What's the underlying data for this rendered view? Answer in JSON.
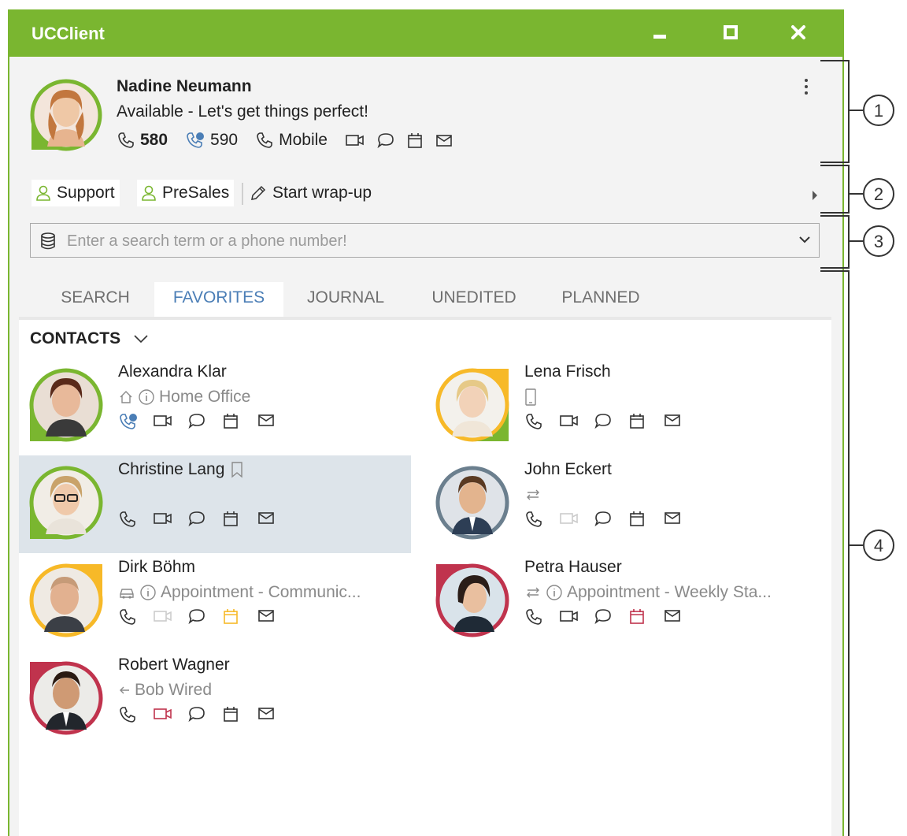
{
  "window": {
    "title": "UCClient",
    "accent": "#7ab630"
  },
  "profile": {
    "name": "Nadine Neumann",
    "status": "Available - Let's get things perfect!",
    "line1": "580",
    "line2": "590",
    "mobile": "Mobile",
    "ring_color": "#7ab630"
  },
  "groups": [
    {
      "label": "Support"
    },
    {
      "label": "PreSales"
    }
  ],
  "wrapup": {
    "label": "Start wrap-up"
  },
  "search": {
    "placeholder": "Enter a search term or a phone number!",
    "value": ""
  },
  "tabs": [
    {
      "label": "SEARCH",
      "active": false
    },
    {
      "label": "FAVORITES",
      "active": true
    },
    {
      "label": "JOURNAL",
      "active": false
    },
    {
      "label": "UNEDITED",
      "active": false
    },
    {
      "label": "PLANNED",
      "active": false
    }
  ],
  "category": {
    "label": "CONTACTS"
  },
  "contacts": [
    {
      "name": "Alexandra Klar",
      "status": "Home Office",
      "status_icon": "home-icon",
      "presence": "available",
      "ring": "#7ab630"
    },
    {
      "name": "Lena Frisch",
      "status": "",
      "status_icon": "mobile-icon",
      "presence": "away",
      "ring": "#f7b928"
    },
    {
      "name": "Christine Lang",
      "status": "",
      "status_icon": "",
      "presence": "available",
      "ring": "#7ab630",
      "selected": true,
      "bookmark": true
    },
    {
      "name": "John Eckert",
      "status": "",
      "status_icon": "offline-icon",
      "presence": "offline",
      "ring": "#6b7f8e"
    },
    {
      "name": "Dirk Böhm",
      "status": "Appointment - Communic...",
      "status_icon": "car-icon",
      "presence": "away",
      "ring": "#f7b928"
    },
    {
      "name": "Petra Hauser",
      "status": "Appointment - Weekly Sta...",
      "status_icon": "offline-icon",
      "presence": "busy",
      "ring": "#c0334d"
    },
    {
      "name": "Robert Wagner",
      "status": "Bob Wired",
      "status_icon": "forward-arrow-icon",
      "presence": "busy",
      "ring": "#c0334d"
    }
  ],
  "callouts": [
    "1",
    "2",
    "3",
    "4"
  ]
}
